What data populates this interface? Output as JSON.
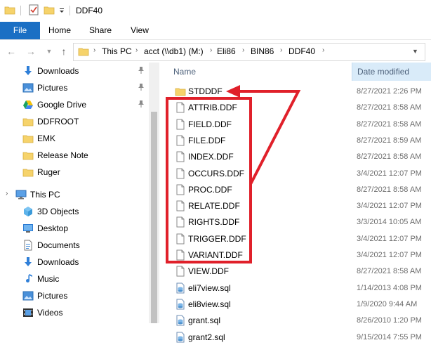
{
  "window": {
    "title": "DDF40"
  },
  "ribbon": {
    "tabs": [
      "File",
      "Home",
      "Share",
      "View"
    ]
  },
  "address": {
    "crumbs": [
      "This PC",
      "acct (\\\\db1) (M:)",
      "Eli86",
      "BIN86",
      "DDF40"
    ]
  },
  "nav": {
    "quick_access": [
      {
        "label": "Downloads",
        "icon": "download-arrow-icon",
        "pinned": true
      },
      {
        "label": "Pictures",
        "icon": "pictures-icon",
        "pinned": true
      },
      {
        "label": "Google Drive",
        "icon": "google-drive-icon",
        "pinned": true
      },
      {
        "label": "DDFROOT",
        "icon": "folder-icon",
        "pinned": false
      },
      {
        "label": "EMK",
        "icon": "folder-icon",
        "pinned": false
      },
      {
        "label": "Release Note",
        "icon": "folder-icon",
        "pinned": false
      },
      {
        "label": "Ruger",
        "icon": "folder-icon",
        "pinned": false
      }
    ],
    "this_pc": {
      "label": "This PC",
      "icon": "computer-icon"
    },
    "pc_items": [
      {
        "label": "3D Objects",
        "icon": "3d-objects-icon"
      },
      {
        "label": "Desktop",
        "icon": "desktop-icon"
      },
      {
        "label": "Documents",
        "icon": "documents-icon"
      },
      {
        "label": "Downloads",
        "icon": "download-arrow-icon"
      },
      {
        "label": "Music",
        "icon": "music-note-icon"
      },
      {
        "label": "Pictures",
        "icon": "pictures-icon"
      },
      {
        "label": "Videos",
        "icon": "videos-icon"
      }
    ]
  },
  "columns": {
    "name": "Name",
    "date": "Date modified"
  },
  "files": [
    {
      "name": "STDDDF",
      "date": "8/27/2021 2:26 PM",
      "icon": "folder-icon"
    },
    {
      "name": "ATTRIB.DDF",
      "date": "8/27/2021 8:58 AM",
      "icon": "file-icon"
    },
    {
      "name": "FIELD.DDF",
      "date": "8/27/2021 8:58 AM",
      "icon": "file-icon"
    },
    {
      "name": "FILE.DDF",
      "date": "8/27/2021 8:59 AM",
      "icon": "file-icon"
    },
    {
      "name": "INDEX.DDF",
      "date": "8/27/2021 8:58 AM",
      "icon": "file-icon"
    },
    {
      "name": "OCCURS.DDF",
      "date": "3/4/2021 12:07 PM",
      "icon": "file-icon"
    },
    {
      "name": "PROC.DDF",
      "date": "8/27/2021 8:58 AM",
      "icon": "file-icon"
    },
    {
      "name": "RELATE.DDF",
      "date": "3/4/2021 12:07 PM",
      "icon": "file-icon"
    },
    {
      "name": "RIGHTS.DDF",
      "date": "3/3/2014 10:05 AM",
      "icon": "file-icon"
    },
    {
      "name": "TRIGGER.DDF",
      "date": "3/4/2021 12:07 PM",
      "icon": "file-icon"
    },
    {
      "name": "VARIANT.DDF",
      "date": "3/4/2021 12:07 PM",
      "icon": "file-icon"
    },
    {
      "name": "VIEW.DDF",
      "date": "8/27/2021 8:58 AM",
      "icon": "file-icon"
    },
    {
      "name": "eli7view.sql",
      "date": "1/14/2013 4:08 PM",
      "icon": "sql-file-icon"
    },
    {
      "name": "eli8view.sql",
      "date": "1/9/2020 9:44 AM",
      "icon": "sql-file-icon"
    },
    {
      "name": "grant.sql",
      "date": "8/26/2010 1:20 PM",
      "icon": "sql-file-icon"
    },
    {
      "name": "grant2.sql",
      "date": "9/15/2014 7:55 PM",
      "icon": "sql-file-icon"
    }
  ],
  "colors": {
    "accent": "#1a6fc4",
    "folder": "#f6d36b",
    "annotation": "#e0202a"
  }
}
